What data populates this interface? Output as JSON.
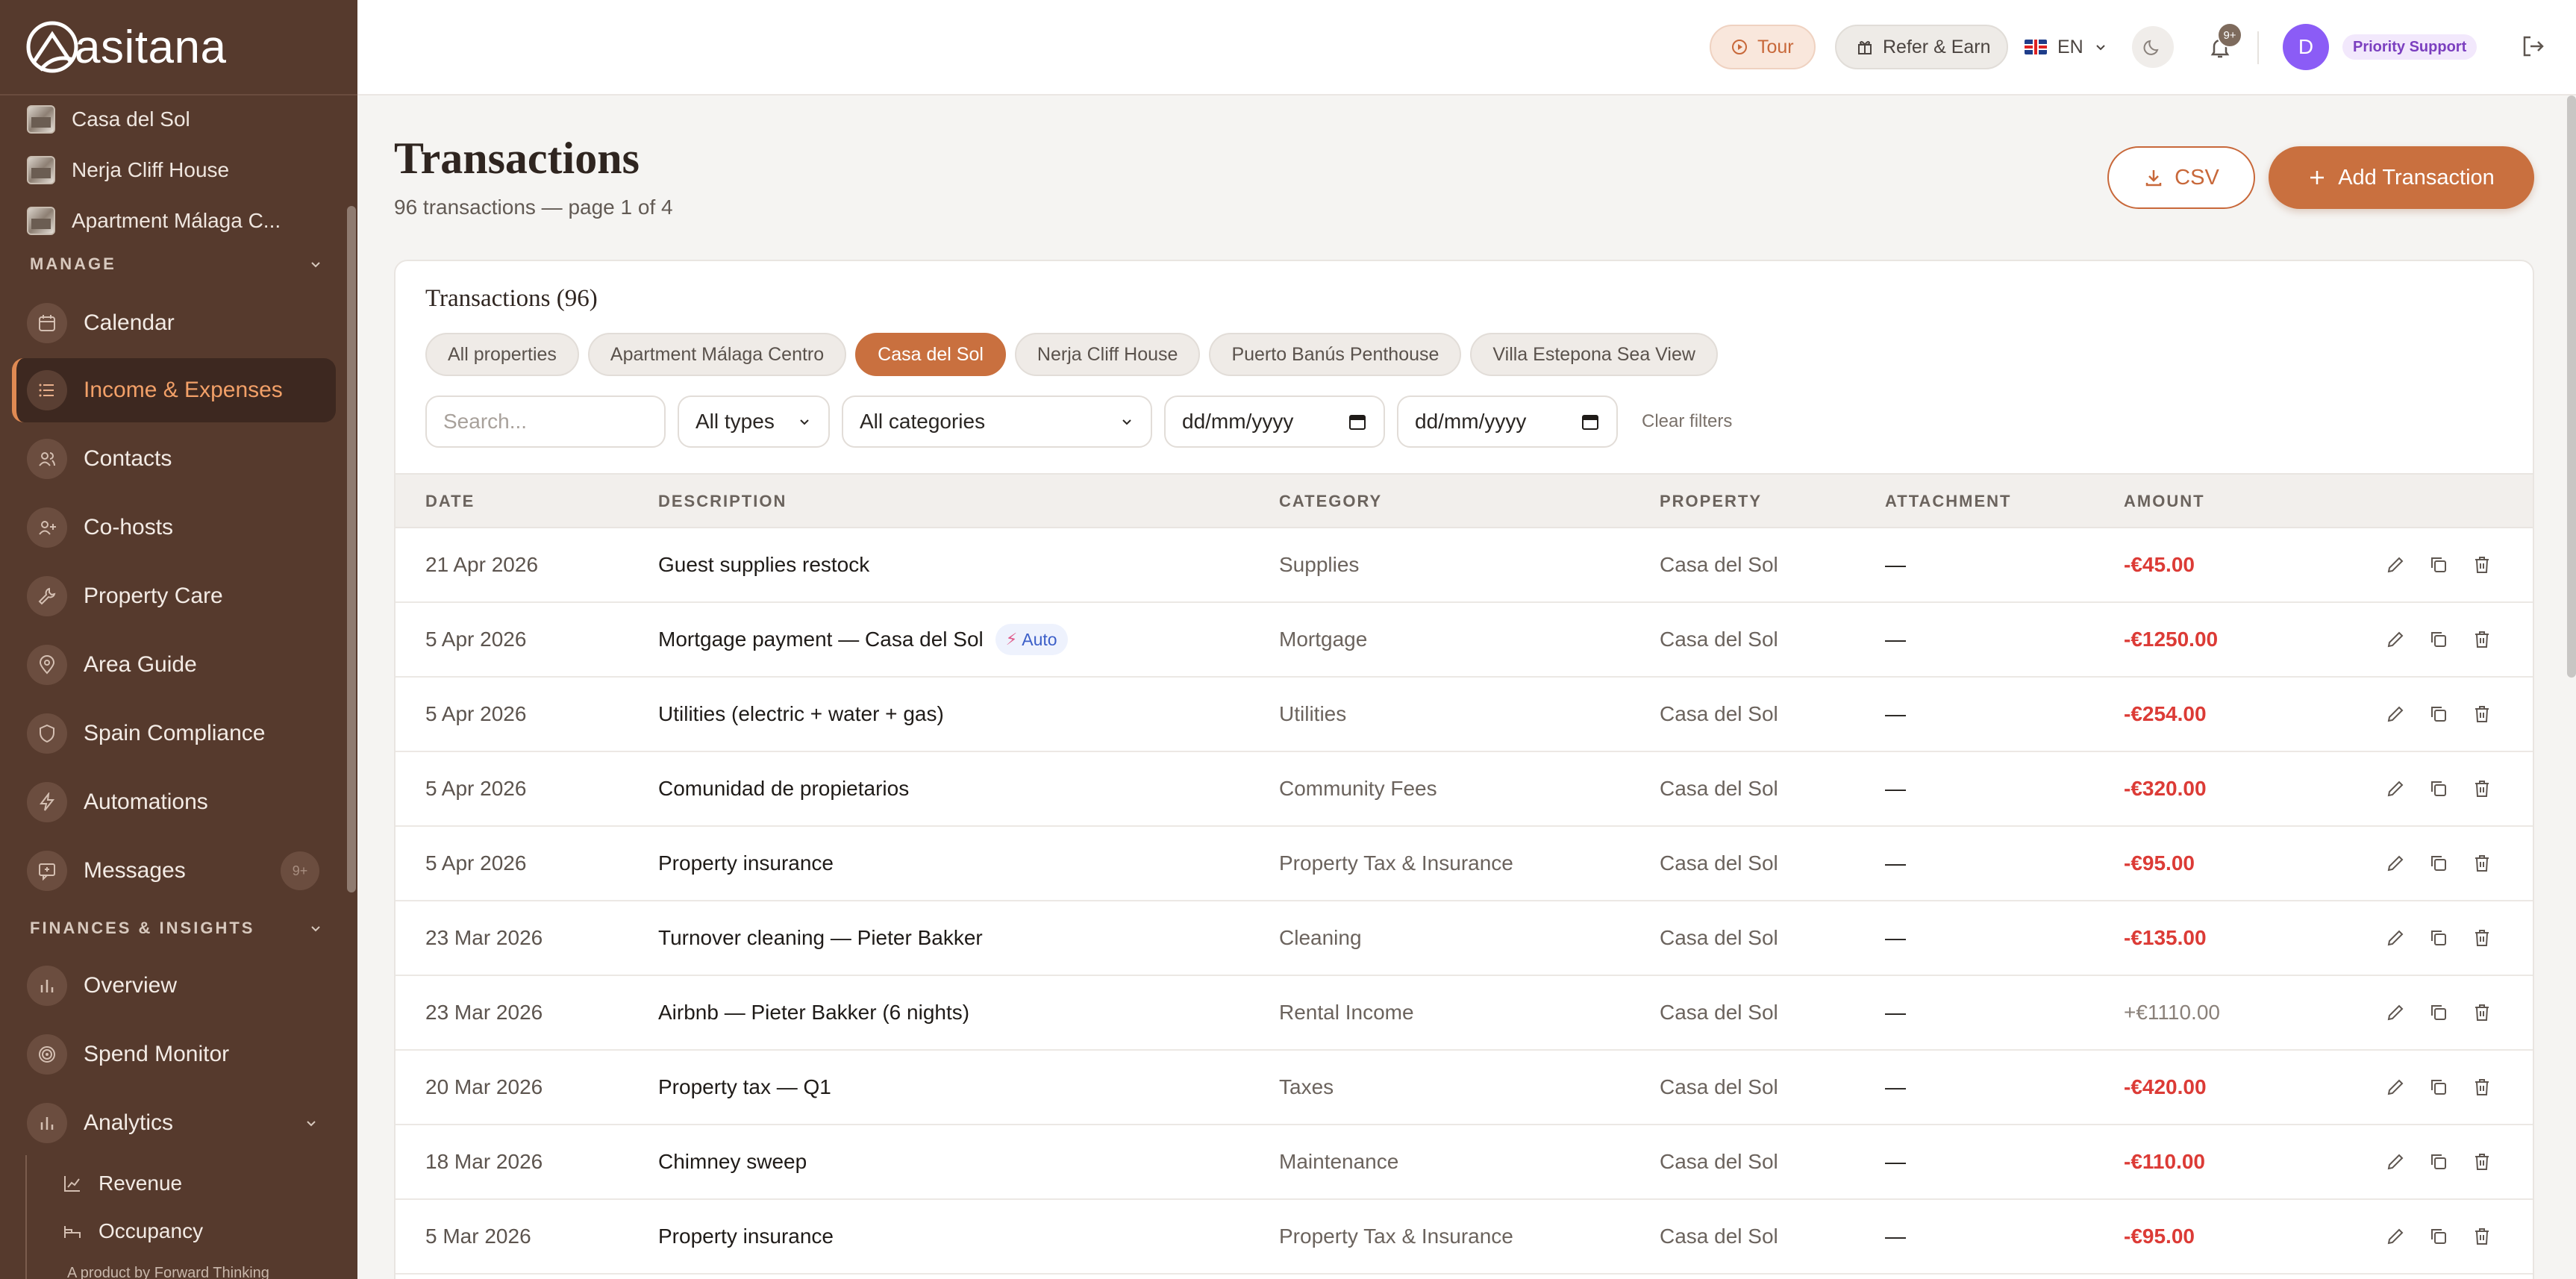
{
  "brand": {
    "name": "asitana"
  },
  "sidebar": {
    "properties": [
      {
        "label": "Casa del Sol"
      },
      {
        "label": "Nerja Cliff House"
      },
      {
        "label": "Apartment Málaga C..."
      }
    ],
    "manage_label": "MANAGE",
    "finances_label": "FINANCES & INSIGHTS",
    "items": [
      {
        "label": "Calendar",
        "icon": "calendar-icon"
      },
      {
        "label": "Income & Expenses",
        "icon": "list-icon",
        "active": true
      },
      {
        "label": "Contacts",
        "icon": "users-icon"
      },
      {
        "label": "Co-hosts",
        "icon": "user-plus-icon"
      },
      {
        "label": "Property Care",
        "icon": "wrench-icon"
      },
      {
        "label": "Area Guide",
        "icon": "map-pin-icon"
      },
      {
        "label": "Spain Compliance",
        "icon": "shield-icon"
      },
      {
        "label": "Automations",
        "icon": "bolt-icon"
      },
      {
        "label": "Messages",
        "icon": "message-icon",
        "badge": "9+"
      }
    ],
    "finance_items": [
      {
        "label": "Overview",
        "icon": "bar-chart-icon"
      },
      {
        "label": "Spend Monitor",
        "icon": "target-icon"
      },
      {
        "label": "Analytics",
        "icon": "bar-chart-icon"
      }
    ],
    "analytics_sub": [
      {
        "label": "Revenue",
        "icon": "line-chart-icon"
      },
      {
        "label": "Occupancy",
        "icon": "bed-icon"
      }
    ],
    "footer": "A product by Forward Thinking"
  },
  "topbar": {
    "tour": "Tour",
    "refer": "Refer & Earn",
    "lang": "EN",
    "notif_badge": "9+",
    "avatar_initial": "D",
    "priority": "Priority Support"
  },
  "page": {
    "title": "Transactions",
    "subtitle": "96 transactions — page 1 of 4",
    "csv_label": "CSV",
    "add_label": "Add Transaction"
  },
  "card": {
    "title": "Transactions (96)",
    "chips": [
      {
        "label": "All properties"
      },
      {
        "label": "Apartment Málaga Centro"
      },
      {
        "label": "Casa del Sol",
        "active": true
      },
      {
        "label": "Nerja Cliff House"
      },
      {
        "label": "Puerto Banús Penthouse"
      },
      {
        "label": "Villa Estepona Sea View"
      }
    ],
    "search_placeholder": "Search...",
    "types_value": "All types",
    "categories_value": "All categories",
    "date_from": "dd/mm/yyyy",
    "date_to": "dd/mm/yyyy",
    "clear": "Clear filters",
    "columns": [
      "DATE",
      "DESCRIPTION",
      "CATEGORY",
      "PROPERTY",
      "ATTACHMENT",
      "AMOUNT"
    ],
    "rows": [
      {
        "date": "21 Apr 2026",
        "desc": "Guest supplies restock",
        "cat": "Supplies",
        "prop": "Casa del Sol",
        "att": "—",
        "amt": "-€45.00",
        "sign": "neg"
      },
      {
        "date": "5 Apr 2026",
        "desc": "Mortgage payment — Casa del Sol",
        "auto": "Auto",
        "cat": "Mortgage",
        "prop": "Casa del Sol",
        "att": "—",
        "amt": "-€1250.00",
        "sign": "neg"
      },
      {
        "date": "5 Apr 2026",
        "desc": "Utilities (electric + water + gas)",
        "cat": "Utilities",
        "prop": "Casa del Sol",
        "att": "—",
        "amt": "-€254.00",
        "sign": "neg"
      },
      {
        "date": "5 Apr 2026",
        "desc": "Comunidad de propietarios",
        "cat": "Community Fees",
        "prop": "Casa del Sol",
        "att": "—",
        "amt": "-€320.00",
        "sign": "neg"
      },
      {
        "date": "5 Apr 2026",
        "desc": "Property insurance",
        "cat": "Property Tax & Insurance",
        "prop": "Casa del Sol",
        "att": "—",
        "amt": "-€95.00",
        "sign": "neg"
      },
      {
        "date": "23 Mar 2026",
        "desc": "Turnover cleaning — Pieter Bakker",
        "cat": "Cleaning",
        "prop": "Casa del Sol",
        "att": "—",
        "amt": "-€135.00",
        "sign": "neg"
      },
      {
        "date": "23 Mar 2026",
        "desc": "Airbnb — Pieter Bakker (6 nights)",
        "cat": "Rental Income",
        "prop": "Casa del Sol",
        "att": "—",
        "amt": "+€1110.00",
        "sign": "pos"
      },
      {
        "date": "20 Mar 2026",
        "desc": "Property tax — Q1",
        "cat": "Taxes",
        "prop": "Casa del Sol",
        "att": "—",
        "amt": "-€420.00",
        "sign": "neg"
      },
      {
        "date": "18 Mar 2026",
        "desc": "Chimney sweep",
        "cat": "Maintenance",
        "prop": "Casa del Sol",
        "att": "—",
        "amt": "-€110.00",
        "sign": "neg"
      },
      {
        "date": "5 Mar 2026",
        "desc": "Property insurance",
        "cat": "Property Tax & Insurance",
        "prop": "Casa del Sol",
        "att": "—",
        "amt": "-€95.00",
        "sign": "neg"
      }
    ]
  },
  "colors": {
    "accent": "#c9703f",
    "sidebar": "#563a2d",
    "negative": "#dc3b36",
    "active_text": "#f2a068"
  }
}
